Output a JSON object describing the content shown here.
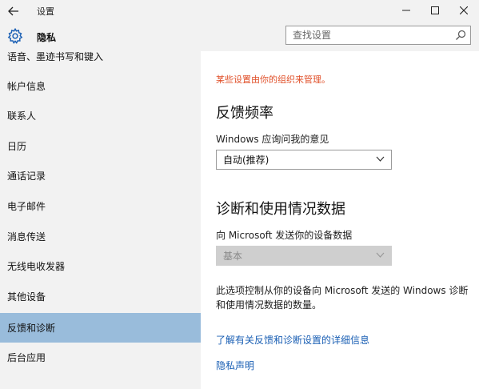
{
  "window": {
    "title": "设置"
  },
  "header": {
    "title": "隐私",
    "search_placeholder": "查找设置"
  },
  "sidebar": {
    "items": [
      {
        "label": "语音、墨迹书写和键入"
      },
      {
        "label": "帐户信息"
      },
      {
        "label": "联系人"
      },
      {
        "label": "日历"
      },
      {
        "label": "通话记录"
      },
      {
        "label": "电子邮件"
      },
      {
        "label": "消息传送"
      },
      {
        "label": "无线电收发器"
      },
      {
        "label": "其他设备"
      },
      {
        "label": "反馈和诊断",
        "active": true
      },
      {
        "label": "后台应用"
      }
    ]
  },
  "content": {
    "notice": "某些设置由你的组织来管理。",
    "feedback_title": "反馈频率",
    "feedback_label": "Windows 应询问我的意见",
    "feedback_value": "自动(推荐)",
    "diag_title": "诊断和使用情况数据",
    "diag_label": "向 Microsoft 发送你的设备数据",
    "diag_value": "基本",
    "description": "此选项控制从你的设备向 Microsoft 发送的 Windows 诊断和使用情况数据的数量。",
    "link_details": "了解有关反馈和诊断设置的详细信息",
    "link_privacy": "隐私声明"
  },
  "colors": {
    "notice": "#e0502a",
    "link": "#1a5fb4",
    "active_nav": "#99bcdb",
    "sidebar_bg": "#f2f2f2"
  }
}
